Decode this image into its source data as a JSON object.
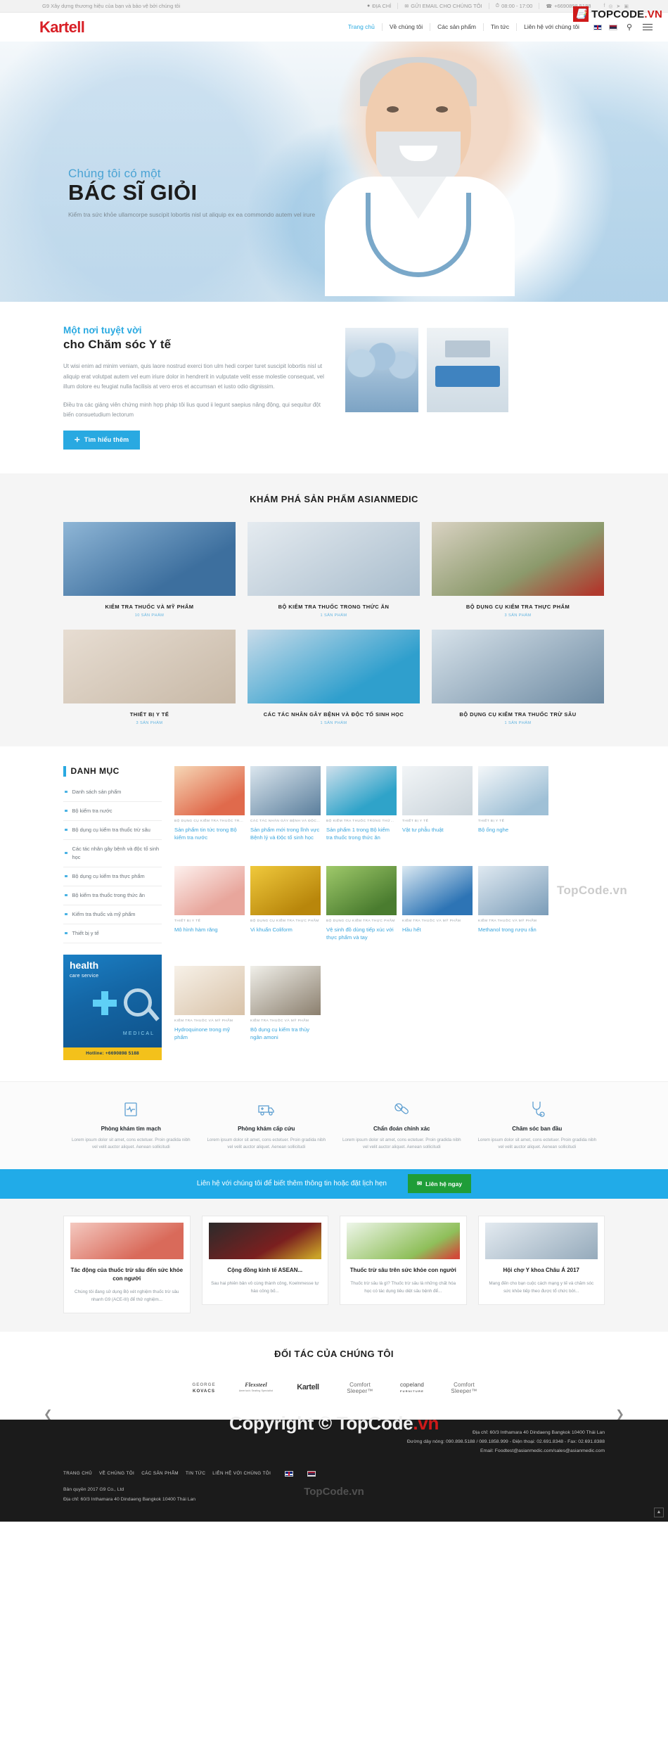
{
  "topbar": {
    "tagline": "G9 Xây dựng thương hiệu của bạn và bảo vệ bởi chúng tôi",
    "address_label": "ĐỊA CHỈ",
    "email_label": "GỬI EMAIL CHO CHÚNG TÔI",
    "hours": "08:00 - 17:00",
    "phone": "+6690898 5188"
  },
  "watermark": {
    "top_badge": "TOPCODE",
    "top_badge_suffix": ".VN",
    "footer_big": "Copyright © TopCode",
    "footer_big_suffix": ".vn",
    "mid": "TopCode.vn",
    "product_area": "TopCode.vn"
  },
  "nav": {
    "logo": "Kartell",
    "items": [
      {
        "label": "Trang chủ",
        "active": true
      },
      {
        "label": "Về chúng tôi",
        "active": false
      },
      {
        "label": "Các sản phẩm",
        "active": false
      },
      {
        "label": "Tin tức",
        "active": false
      },
      {
        "label": "Liên hệ với chúng tôi",
        "active": false
      }
    ],
    "search_icon": "search-icon",
    "menu_icon": "hamburger-icon"
  },
  "hero": {
    "kicker": "Chúng tôi có một",
    "title": "BÁC SĨ GIỎI",
    "desc": "Kiểm tra sức khỏe ullamcorpe suscipit lobortis nisl ut aliquip ex ea commondo autem vel irure"
  },
  "about": {
    "kicker": "Một  nơi tuyệt vời",
    "title": "cho  Chăm sóc Y tế",
    "paragraph1": "Ut wisi enim ad minim veniam, quis laore nostrud exerci tion ulm hedi corper turet suscipit lobortis nisl ut aliquip erat volutpat autem vel eum iriure dolor in hendrerit in vulputate velit esse molestie consequat, vel illum dolore eu feugiat nulla facilisis at vero eros et accumsan et iusto odio dignissim.",
    "paragraph2": "Điều tra các giảng viên chứng minh hợp pháp tôi lius quod ii legunt saepius năng động, qui sequitur đột biến consuetudium lectorum",
    "button": "Tìm hiểu thêm"
  },
  "explore": {
    "title": "KHÁM PHÁ SẢN PHẨM ASIANMEDIC",
    "categories": [
      {
        "name": "KIỂM TRA THUỐC VÀ MỸ PHẨM",
        "count": "10 SẢN PHẨM"
      },
      {
        "name": "BỘ KIỂM TRA THUỐC TRONG THỨC ĂN",
        "count": "1 SẢN PHẨM"
      },
      {
        "name": "BỘ DỤNG CỤ KIỂM TRA THỰC PHẨM",
        "count": "3 SẢN PHẨM"
      },
      {
        "name": "THIẾT BỊ Y TẾ",
        "count": "3 SẢN PHẨM"
      },
      {
        "name": "CÁC TÁC NHÂN GÂY BỆNH VÀ ĐỘC TỐ SINH HỌC",
        "count": "1 SẢN PHẨM"
      },
      {
        "name": "BỘ DỤNG CỤ KIỂM TRA THUỐC TRỪ SÂU",
        "count": "1 SẢN PHẨM"
      }
    ]
  },
  "shop": {
    "sidebar_title": "DANH MỤC",
    "sidebar_items": [
      "Danh sách sản phẩm",
      "Bộ kiểm tra nước",
      "Bộ dụng cụ kiểm tra thuốc trừ sâu",
      "Các tác nhân gây bệnh và độc tố sinh học",
      "Bộ dụng cụ kiểm tra thực phẩm",
      "Bộ kiểm tra thuốc trong thức ăn",
      "Kiểm tra thuốc và mỹ phẩm",
      "Thiết bị y tế"
    ],
    "promo": {
      "title": "health",
      "subtitle": "care service",
      "medical_label": "MEDICAL",
      "hotline": "Hotline: +6690898 5188"
    },
    "products": [
      {
        "category": "BỘ DỤNG CỤ KIỂM TRA THUỐC TR...",
        "name": "Sản phẩm tin tức trong Bộ kiểm tra nước"
      },
      {
        "category": "CÁC TÁC NHÂN GÂY BỆNH VÀ ĐỘC ...",
        "name": "Sản phẩm mới trong lĩnh vực Bệnh lý và Độc tố sinh học"
      },
      {
        "category": "BỘ KIỂM TRA THUỐC TRONG THỨC...",
        "name": "Sản phẩm 1 trong Bộ kiểm tra thuốc trong thức ăn"
      },
      {
        "category": "THIẾT BỊ Y TẾ",
        "name": "Vật tư phẫu thuật"
      },
      {
        "category": "THIẾT BỊ Y TẾ",
        "name": "Bộ ống nghe"
      },
      {
        "category": "THIẾT BỊ Y TẾ",
        "name": "Mô hình hàm răng"
      },
      {
        "category": "BỘ DỤNG CỤ KIỂM TRA THỰC PHẨM",
        "name": "Vi khuẩn Coliform"
      },
      {
        "category": "BỘ DỤNG CỤ KIỂM TRA THỰC PHẨM",
        "name": "Vệ sinh đồ dùng tiếp xúc với thực phẩm và tay"
      },
      {
        "category": "KIỂM TRA THUỐC VÀ MỸ PHẨM",
        "name": "Hầu hết"
      },
      {
        "category": "KIỂM TRA THUỐC VÀ MỸ PHẨM",
        "name": "Methanol trong rượu rắn"
      },
      {
        "category": "KIỂM TRA THUỐC VÀ MỸ PHẨM",
        "name": "Hydroquinone trong mỹ phẩm"
      },
      {
        "category": "KIỂM TRA THUỐC VÀ MỸ PHẨM",
        "name": "Bộ dụng cụ kiểm tra thủy ngân amoni"
      }
    ]
  },
  "features": [
    {
      "icon": "cardiogram-icon",
      "name": "Phòng khám tim mạch",
      "text": "Lorem ipsum dolor sit amet, cons ectetuer. Proin gradida nibh vel velit auctor aliquet. Aenean sollicitudi"
    },
    {
      "icon": "ambulance-icon",
      "name": "Phòng khám cấp cứu",
      "text": "Lorem ipsum dolor sit amet, cons ectetuer. Proin gradida nibh vel velit auctor aliquet. Aenean sollicitudi"
    },
    {
      "icon": "pills-icon",
      "name": "Chẩn đoán chính xác",
      "text": "Lorem ipsum dolor sit amet, cons ectetuer. Proin gradida nibh vel velit auctor aliquet. Aenean sollicitudi"
    },
    {
      "icon": "stethoscope-icon",
      "name": "Chăm sóc ban đầu",
      "text": "Lorem ipsum dolor sit amet, cons ectetuer. Proin gradida nibh vel velit auctor aliquet. Aenean sollicitudi"
    }
  ],
  "cta": {
    "text": "Liên hệ với chúng tôi để biết thêm thông tin hoặc đặt lịch hẹn",
    "button": "Liên hệ ngay"
  },
  "news": [
    {
      "title": "Tác động của thuốc trừ sâu đến sức khỏe con người",
      "excerpt": "Chúng tôi đang sử dụng Bộ xét nghiệm thuốc trừ sâu nhanh G9 (ACE-III) để thử nghiệm..."
    },
    {
      "title": "Cộng đồng kinh tế ASEAN...",
      "excerpt": "Sau hai phiên bản vô cùng thành công, Koelnmesse tự hào công bố..."
    },
    {
      "title": "Thuốc trừ sâu trên sức khỏe con người",
      "excerpt": "Thuốc trừ sâu là gì? Thuốc trừ sâu là những chất hóa học có tác dụng tiêu diệt sâu bệnh để..."
    },
    {
      "title": "Hội chợ Y khoa Châu Á 2017",
      "excerpt": "Mang đến cho bạn cuộc cách mạng y tế và chăm sóc sức khỏe tiếp theo được tổ chức bởi..."
    }
  ],
  "partners": {
    "title": "ĐỐI TÁC CỦA CHÚNG TÔI",
    "logos": [
      {
        "line1": "GEORGE",
        "line2": "KOVACS",
        "style": "kovacs"
      },
      {
        "line1": "Flexsteel",
        "line2": "America's Seating Specialist",
        "style": "flexsteel"
      },
      {
        "line1": "Kartell",
        "line2": "",
        "style": "kartell"
      },
      {
        "line1": "Comfort",
        "line2": "Sleeper™",
        "style": "comfort"
      },
      {
        "line1": "copeland",
        "line2": "FURNITURE",
        "style": "copeland"
      },
      {
        "line1": "Comfort",
        "line2": "Sleeper™",
        "style": "comfort"
      }
    ],
    "prev_icon": "chevron-left-icon",
    "next_icon": "chevron-right-icon"
  },
  "footer": {
    "address": "Địa chỉ: 60/3 Inthamara 40 Dindaeng Bangkok 10400 Thái Lan",
    "hotline": "Đường dây nóng: 090.898.5188 / 089.1858.999 - Điện thoại: 02.691.8348 - Fax: 02.691.8388",
    "email": "Email: Foodtest@asianmedic.com/sales@asianmedic.com",
    "nav": [
      "TRANG CHỦ",
      "VỀ CHÚNG TÔI",
      "CÁC SẢN PHẨM",
      "TIN TỨC",
      "LIÊN HỆ VỚI CHÚNG TÔI"
    ],
    "copyright": "Bản quyền 2017 G9 Co., Ltd",
    "address2": "Địa chỉ: 60/3 Inthamara 40 Dindaeng Bangkok 10400 Thái Lan",
    "scroll_top_icon": "chevron-up-icon"
  }
}
